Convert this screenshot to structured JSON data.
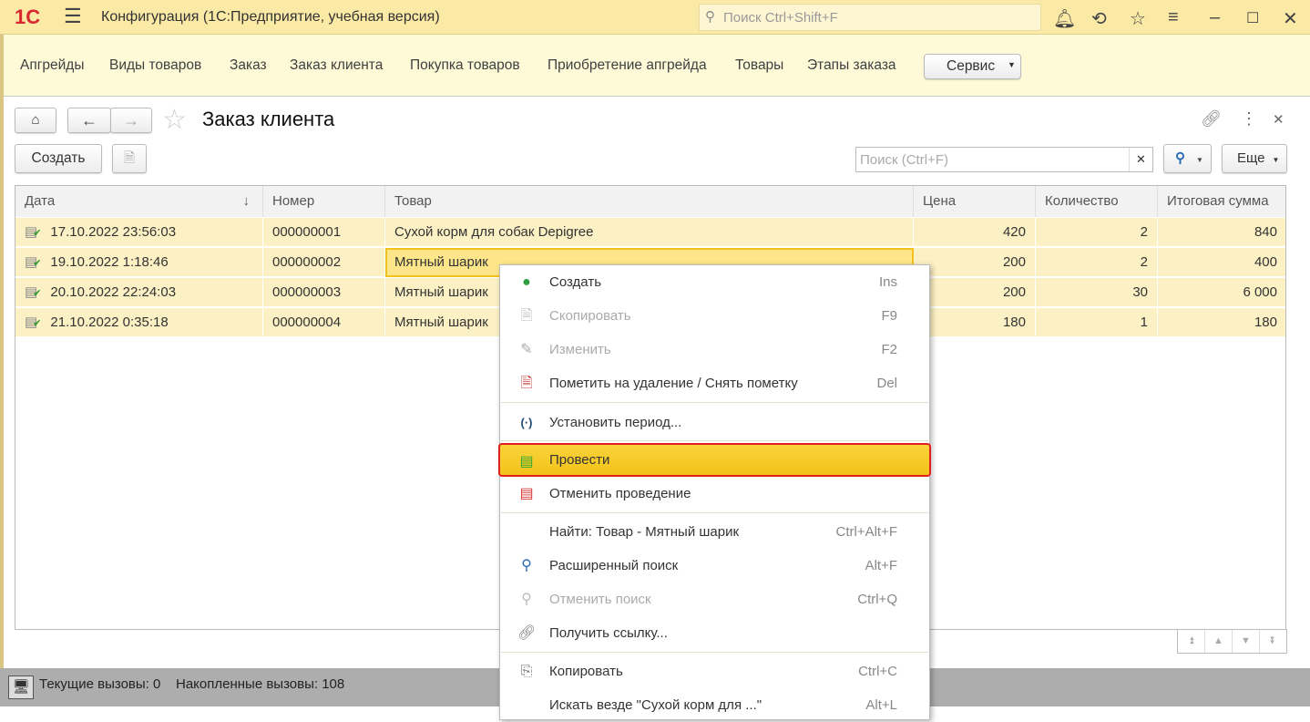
{
  "titlebar": {
    "logo": "1С",
    "title": "Конфигурация  (1С:Предприятие, учебная версия)",
    "search_placeholder": "Поиск Ctrl+Shift+F"
  },
  "sections": {
    "items": [
      "Апгрейды",
      "Виды товаров",
      "Заказ",
      "Заказ клиента",
      "Покупка товаров",
      "Приобретение апгрейда",
      "Товары",
      "Этапы заказа"
    ],
    "service_label": "Сервис"
  },
  "form": {
    "title": "Заказ клиента",
    "create_label": "Создать",
    "search_placeholder": "Поиск (Ctrl+F)",
    "more_label": "Еще"
  },
  "table": {
    "headers": [
      "Дата",
      "Номер",
      "Товар",
      "Цена",
      "Количество",
      "Итоговая сумма"
    ],
    "rows": [
      {
        "date": "17.10.2022 23:56:03",
        "number": "000000001",
        "product": "Сухой корм для собак Depigree",
        "price": "420",
        "qty": "2",
        "total": "840"
      },
      {
        "date": "19.10.2022 1:18:46",
        "number": "000000002",
        "product": "Мятный шарик",
        "price": "200",
        "qty": "2",
        "total": "400"
      },
      {
        "date": "20.10.2022 22:24:03",
        "number": "000000003",
        "product": "Мятный шарик",
        "price": "200",
        "qty": "30",
        "total": "6 000"
      },
      {
        "date": "21.10.2022 0:35:18",
        "number": "000000004",
        "product": "Мятный шарик",
        "price": "180",
        "qty": "1",
        "total": "180"
      }
    ]
  },
  "context_menu": {
    "items": [
      {
        "label": "Создать",
        "shortcut": "Ins",
        "icon": "plus-circle-icon"
      },
      {
        "label": "Скопировать",
        "shortcut": "F9",
        "icon": "copy-doc-icon",
        "disabled": true
      },
      {
        "label": "Изменить",
        "shortcut": "F2",
        "icon": "pencil-icon",
        "disabled": true
      },
      {
        "label": "Пометить на удаление / Снять пометку",
        "shortcut": "Del",
        "icon": "delete-mark-icon"
      },
      {
        "label": "Установить период...",
        "shortcut": "",
        "icon": "period-icon"
      },
      {
        "label": "Провести",
        "shortcut": "",
        "icon": "post-icon",
        "highlighted": true
      },
      {
        "label": "Отменить проведение",
        "shortcut": "",
        "icon": "unpost-icon"
      },
      {
        "label": "Найти: Товар - Мятный шарик",
        "shortcut": "Ctrl+Alt+F",
        "icon": ""
      },
      {
        "label": "Расширенный поиск",
        "shortcut": "Alt+F",
        "icon": "search-icon"
      },
      {
        "label": "Отменить поиск",
        "shortcut": "Ctrl+Q",
        "icon": "cancel-search-icon",
        "disabled": true
      },
      {
        "label": "Получить ссылку...",
        "shortcut": "",
        "icon": "link-icon"
      },
      {
        "label": "Копировать",
        "shortcut": "Ctrl+C",
        "icon": "copy-icon"
      },
      {
        "label": "Искать везде \"Сухой корм для ...\"",
        "shortcut": "Alt+L",
        "icon": ""
      }
    ]
  },
  "status": {
    "current_calls": "Текущие вызовы: 0",
    "accumulated_calls": "Накопленные вызовы: 108"
  },
  "colors": {
    "accent": "#f7c81e",
    "highlight_border": "#e02020",
    "row_bg": "#fcf1c4"
  }
}
